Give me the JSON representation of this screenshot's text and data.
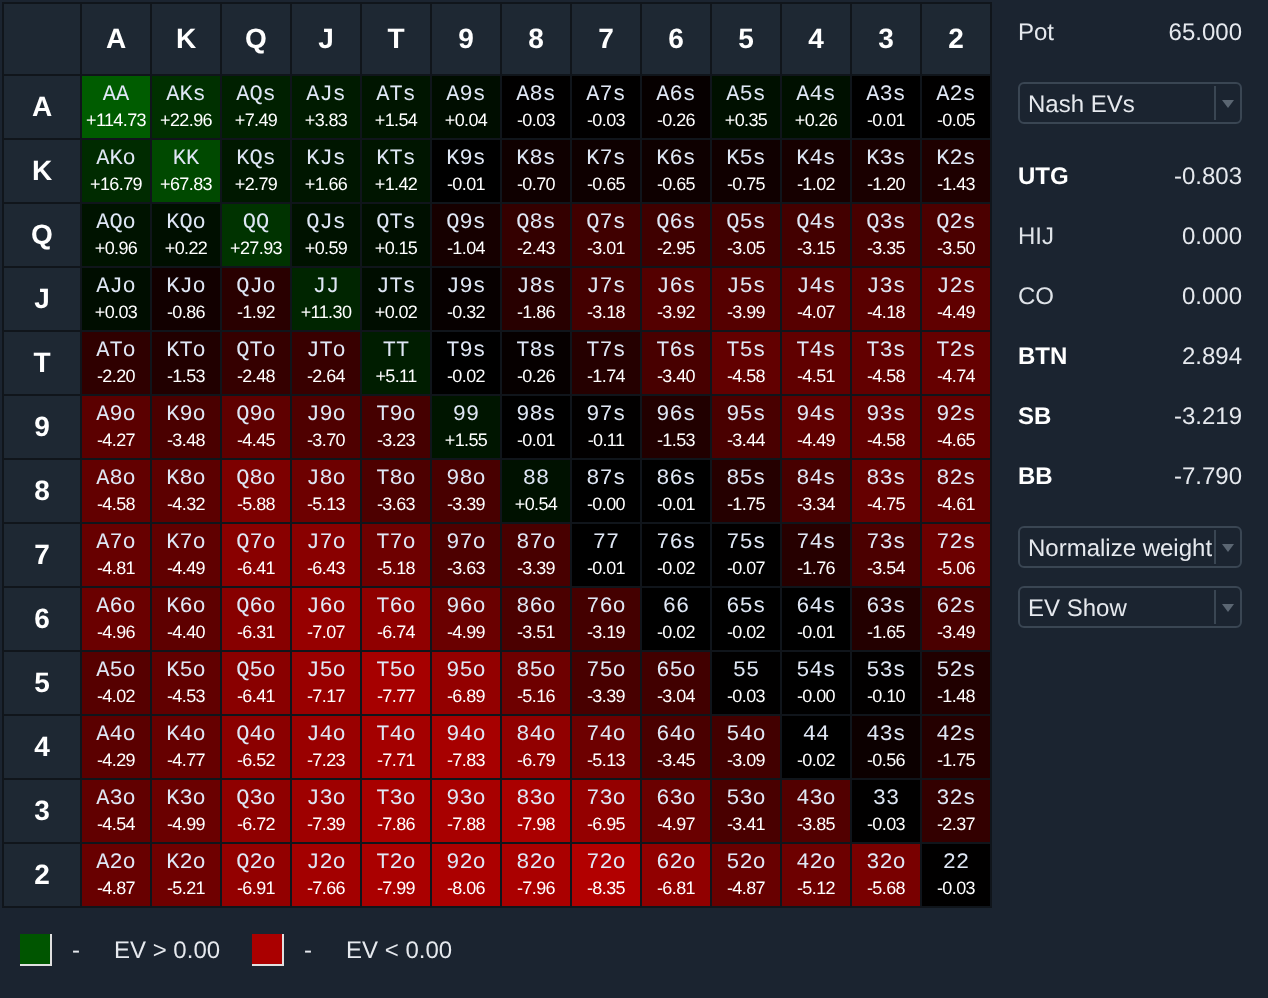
{
  "matrix": {
    "column_headers": [
      "A",
      "K",
      "Q",
      "J",
      "T",
      "9",
      "8",
      "7",
      "6",
      "5",
      "4",
      "3",
      "2"
    ],
    "rows": [
      {
        "header": "A",
        "cells": [
          {
            "hand": "AA",
            "ev": "+114.73"
          },
          {
            "hand": "AKs",
            "ev": "+22.96"
          },
          {
            "hand": "AQs",
            "ev": "+7.49"
          },
          {
            "hand": "AJs",
            "ev": "+3.83"
          },
          {
            "hand": "ATs",
            "ev": "+1.54"
          },
          {
            "hand": "A9s",
            "ev": "+0.04"
          },
          {
            "hand": "A8s",
            "ev": "-0.03"
          },
          {
            "hand": "A7s",
            "ev": "-0.03"
          },
          {
            "hand": "A6s",
            "ev": "-0.26"
          },
          {
            "hand": "A5s",
            "ev": "+0.35"
          },
          {
            "hand": "A4s",
            "ev": "+0.26"
          },
          {
            "hand": "A3s",
            "ev": "-0.01"
          },
          {
            "hand": "A2s",
            "ev": "-0.05"
          }
        ]
      },
      {
        "header": "K",
        "cells": [
          {
            "hand": "AKo",
            "ev": "+16.79"
          },
          {
            "hand": "KK",
            "ev": "+67.83"
          },
          {
            "hand": "KQs",
            "ev": "+2.79"
          },
          {
            "hand": "KJs",
            "ev": "+1.66"
          },
          {
            "hand": "KTs",
            "ev": "+1.42"
          },
          {
            "hand": "K9s",
            "ev": "-0.01"
          },
          {
            "hand": "K8s",
            "ev": "-0.70"
          },
          {
            "hand": "K7s",
            "ev": "-0.65"
          },
          {
            "hand": "K6s",
            "ev": "-0.65"
          },
          {
            "hand": "K5s",
            "ev": "-0.75"
          },
          {
            "hand": "K4s",
            "ev": "-1.02"
          },
          {
            "hand": "K3s",
            "ev": "-1.20"
          },
          {
            "hand": "K2s",
            "ev": "-1.43"
          }
        ]
      },
      {
        "header": "Q",
        "cells": [
          {
            "hand": "AQo",
            "ev": "+0.96"
          },
          {
            "hand": "KQo",
            "ev": "+0.22"
          },
          {
            "hand": "QQ",
            "ev": "+27.93"
          },
          {
            "hand": "QJs",
            "ev": "+0.59"
          },
          {
            "hand": "QTs",
            "ev": "+0.15"
          },
          {
            "hand": "Q9s",
            "ev": "-1.04"
          },
          {
            "hand": "Q8s",
            "ev": "-2.43"
          },
          {
            "hand": "Q7s",
            "ev": "-3.01"
          },
          {
            "hand": "Q6s",
            "ev": "-2.95"
          },
          {
            "hand": "Q5s",
            "ev": "-3.05"
          },
          {
            "hand": "Q4s",
            "ev": "-3.15"
          },
          {
            "hand": "Q3s",
            "ev": "-3.35"
          },
          {
            "hand": "Q2s",
            "ev": "-3.50"
          }
        ]
      },
      {
        "header": "J",
        "cells": [
          {
            "hand": "AJo",
            "ev": "+0.03"
          },
          {
            "hand": "KJo",
            "ev": "-0.86"
          },
          {
            "hand": "QJo",
            "ev": "-1.92"
          },
          {
            "hand": "JJ",
            "ev": "+11.30"
          },
          {
            "hand": "JTs",
            "ev": "+0.02"
          },
          {
            "hand": "J9s",
            "ev": "-0.32"
          },
          {
            "hand": "J8s",
            "ev": "-1.86"
          },
          {
            "hand": "J7s",
            "ev": "-3.18"
          },
          {
            "hand": "J6s",
            "ev": "-3.92"
          },
          {
            "hand": "J5s",
            "ev": "-3.99"
          },
          {
            "hand": "J4s",
            "ev": "-4.07"
          },
          {
            "hand": "J3s",
            "ev": "-4.18"
          },
          {
            "hand": "J2s",
            "ev": "-4.49"
          }
        ]
      },
      {
        "header": "T",
        "cells": [
          {
            "hand": "ATo",
            "ev": "-2.20"
          },
          {
            "hand": "KTo",
            "ev": "-1.53"
          },
          {
            "hand": "QTo",
            "ev": "-2.48"
          },
          {
            "hand": "JTo",
            "ev": "-2.64"
          },
          {
            "hand": "TT",
            "ev": "+5.11"
          },
          {
            "hand": "T9s",
            "ev": "-0.02"
          },
          {
            "hand": "T8s",
            "ev": "-0.26"
          },
          {
            "hand": "T7s",
            "ev": "-1.74"
          },
          {
            "hand": "T6s",
            "ev": "-3.40"
          },
          {
            "hand": "T5s",
            "ev": "-4.58"
          },
          {
            "hand": "T4s",
            "ev": "-4.51"
          },
          {
            "hand": "T3s",
            "ev": "-4.58"
          },
          {
            "hand": "T2s",
            "ev": "-4.74"
          }
        ]
      },
      {
        "header": "9",
        "cells": [
          {
            "hand": "A9o",
            "ev": "-4.27"
          },
          {
            "hand": "K9o",
            "ev": "-3.48"
          },
          {
            "hand": "Q9o",
            "ev": "-4.45"
          },
          {
            "hand": "J9o",
            "ev": "-3.70"
          },
          {
            "hand": "T9o",
            "ev": "-3.23"
          },
          {
            "hand": "99",
            "ev": "+1.55"
          },
          {
            "hand": "98s",
            "ev": "-0.01"
          },
          {
            "hand": "97s",
            "ev": "-0.11"
          },
          {
            "hand": "96s",
            "ev": "-1.53"
          },
          {
            "hand": "95s",
            "ev": "-3.44"
          },
          {
            "hand": "94s",
            "ev": "-4.49"
          },
          {
            "hand": "93s",
            "ev": "-4.58"
          },
          {
            "hand": "92s",
            "ev": "-4.65"
          }
        ]
      },
      {
        "header": "8",
        "cells": [
          {
            "hand": "A8o",
            "ev": "-4.58"
          },
          {
            "hand": "K8o",
            "ev": "-4.32"
          },
          {
            "hand": "Q8o",
            "ev": "-5.88"
          },
          {
            "hand": "J8o",
            "ev": "-5.13"
          },
          {
            "hand": "T8o",
            "ev": "-3.63"
          },
          {
            "hand": "98o",
            "ev": "-3.39"
          },
          {
            "hand": "88",
            "ev": "+0.54"
          },
          {
            "hand": "87s",
            "ev": "-0.00"
          },
          {
            "hand": "86s",
            "ev": "-0.01"
          },
          {
            "hand": "85s",
            "ev": "-1.75"
          },
          {
            "hand": "84s",
            "ev": "-3.34"
          },
          {
            "hand": "83s",
            "ev": "-4.75"
          },
          {
            "hand": "82s",
            "ev": "-4.61"
          }
        ]
      },
      {
        "header": "7",
        "cells": [
          {
            "hand": "A7o",
            "ev": "-4.81"
          },
          {
            "hand": "K7o",
            "ev": "-4.49"
          },
          {
            "hand": "Q7o",
            "ev": "-6.41"
          },
          {
            "hand": "J7o",
            "ev": "-6.43"
          },
          {
            "hand": "T7o",
            "ev": "-5.18"
          },
          {
            "hand": "97o",
            "ev": "-3.63"
          },
          {
            "hand": "87o",
            "ev": "-3.39"
          },
          {
            "hand": "77",
            "ev": "-0.01"
          },
          {
            "hand": "76s",
            "ev": "-0.02"
          },
          {
            "hand": "75s",
            "ev": "-0.07"
          },
          {
            "hand": "74s",
            "ev": "-1.76"
          },
          {
            "hand": "73s",
            "ev": "-3.54"
          },
          {
            "hand": "72s",
            "ev": "-5.06"
          }
        ]
      },
      {
        "header": "6",
        "cells": [
          {
            "hand": "A6o",
            "ev": "-4.96"
          },
          {
            "hand": "K6o",
            "ev": "-4.40"
          },
          {
            "hand": "Q6o",
            "ev": "-6.31"
          },
          {
            "hand": "J6o",
            "ev": "-7.07"
          },
          {
            "hand": "T6o",
            "ev": "-6.74"
          },
          {
            "hand": "96o",
            "ev": "-4.99"
          },
          {
            "hand": "86o",
            "ev": "-3.51"
          },
          {
            "hand": "76o",
            "ev": "-3.19"
          },
          {
            "hand": "66",
            "ev": "-0.02"
          },
          {
            "hand": "65s",
            "ev": "-0.02"
          },
          {
            "hand": "64s",
            "ev": "-0.01"
          },
          {
            "hand": "63s",
            "ev": "-1.65"
          },
          {
            "hand": "62s",
            "ev": "-3.49"
          }
        ]
      },
      {
        "header": "5",
        "cells": [
          {
            "hand": "A5o",
            "ev": "-4.02"
          },
          {
            "hand": "K5o",
            "ev": "-4.53"
          },
          {
            "hand": "Q5o",
            "ev": "-6.41"
          },
          {
            "hand": "J5o",
            "ev": "-7.17"
          },
          {
            "hand": "T5o",
            "ev": "-7.77"
          },
          {
            "hand": "95o",
            "ev": "-6.89"
          },
          {
            "hand": "85o",
            "ev": "-5.16"
          },
          {
            "hand": "75o",
            "ev": "-3.39"
          },
          {
            "hand": "65o",
            "ev": "-3.04"
          },
          {
            "hand": "55",
            "ev": "-0.03"
          },
          {
            "hand": "54s",
            "ev": "-0.00"
          },
          {
            "hand": "53s",
            "ev": "-0.10"
          },
          {
            "hand": "52s",
            "ev": "-1.48"
          }
        ]
      },
      {
        "header": "4",
        "cells": [
          {
            "hand": "A4o",
            "ev": "-4.29"
          },
          {
            "hand": "K4o",
            "ev": "-4.77"
          },
          {
            "hand": "Q4o",
            "ev": "-6.52"
          },
          {
            "hand": "J4o",
            "ev": "-7.23"
          },
          {
            "hand": "T4o",
            "ev": "-7.71"
          },
          {
            "hand": "94o",
            "ev": "-7.83"
          },
          {
            "hand": "84o",
            "ev": "-6.79"
          },
          {
            "hand": "74o",
            "ev": "-5.13"
          },
          {
            "hand": "64o",
            "ev": "-3.45"
          },
          {
            "hand": "54o",
            "ev": "-3.09"
          },
          {
            "hand": "44",
            "ev": "-0.02"
          },
          {
            "hand": "43s",
            "ev": "-0.56"
          },
          {
            "hand": "42s",
            "ev": "-1.75"
          }
        ]
      },
      {
        "header": "3",
        "cells": [
          {
            "hand": "A3o",
            "ev": "-4.54"
          },
          {
            "hand": "K3o",
            "ev": "-4.99"
          },
          {
            "hand": "Q3o",
            "ev": "-6.72"
          },
          {
            "hand": "J3o",
            "ev": "-7.39"
          },
          {
            "hand": "T3o",
            "ev": "-7.86"
          },
          {
            "hand": "93o",
            "ev": "-7.88"
          },
          {
            "hand": "83o",
            "ev": "-7.98"
          },
          {
            "hand": "73o",
            "ev": "-6.95"
          },
          {
            "hand": "63o",
            "ev": "-4.97"
          },
          {
            "hand": "53o",
            "ev": "-3.41"
          },
          {
            "hand": "43o",
            "ev": "-3.85"
          },
          {
            "hand": "33",
            "ev": "-0.03"
          },
          {
            "hand": "32s",
            "ev": "-2.37"
          }
        ]
      },
      {
        "header": "2",
        "cells": [
          {
            "hand": "A2o",
            "ev": "-4.87"
          },
          {
            "hand": "K2o",
            "ev": "-5.21"
          },
          {
            "hand": "Q2o",
            "ev": "-6.91"
          },
          {
            "hand": "J2o",
            "ev": "-7.66"
          },
          {
            "hand": "T2o",
            "ev": "-7.99"
          },
          {
            "hand": "92o",
            "ev": "-8.06"
          },
          {
            "hand": "82o",
            "ev": "-7.96"
          },
          {
            "hand": "72o",
            "ev": "-8.35"
          },
          {
            "hand": "62o",
            "ev": "-6.81"
          },
          {
            "hand": "52o",
            "ev": "-4.87"
          },
          {
            "hand": "42o",
            "ev": "-5.12"
          },
          {
            "hand": "32o",
            "ev": "-5.68"
          },
          {
            "hand": "22",
            "ev": "-0.03"
          }
        ]
      }
    ]
  },
  "legend": [
    {
      "color": "#005500",
      "dash": "-",
      "label": "EV > 0.00"
    },
    {
      "color": "#aa0000",
      "dash": "-",
      "label": "EV < 0.00"
    }
  ],
  "side_panel": {
    "pot": {
      "label": "Pot",
      "value": "65.000"
    },
    "ev_dropdown": {
      "value": "Nash EVs"
    },
    "positions": [
      {
        "name": "UTG",
        "ev": "-0.803",
        "highlighted": true
      },
      {
        "name": "HIJ",
        "ev": "0.000",
        "highlighted": false
      },
      {
        "name": "CO",
        "ev": "0.000",
        "highlighted": false
      },
      {
        "name": "BTN",
        "ev": "2.894",
        "highlighted": true
      },
      {
        "name": "SB",
        "ev": "-3.219",
        "highlighted": true
      },
      {
        "name": "BB",
        "ev": "-7.790",
        "highlighted": true
      }
    ],
    "dropdowns": [
      {
        "value": "Normalize weight"
      },
      {
        "value": "EV Show"
      }
    ]
  }
}
